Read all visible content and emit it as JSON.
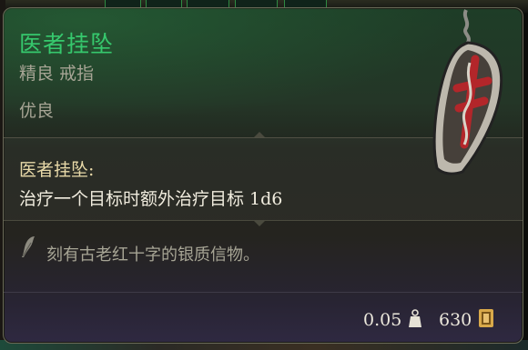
{
  "item": {
    "name": "医者挂坠",
    "type_line": "精良 戒指",
    "rarity": "优良",
    "passive_name": "医者挂坠:",
    "passive_description": "治疗一个目标时额外治疗目标 1d6",
    "flavor_text": "刻有古老红十字的银质信物。",
    "weight": "0.05",
    "price": "630",
    "icons": [
      "pendant-item-image",
      "feather-icon",
      "weight-icon",
      "gold-coin-icon"
    ],
    "colors": {
      "name": "#36c86d",
      "passive_name": "#e8d9a8",
      "body_text": "#a7a595",
      "border": "#6a6a58"
    }
  }
}
